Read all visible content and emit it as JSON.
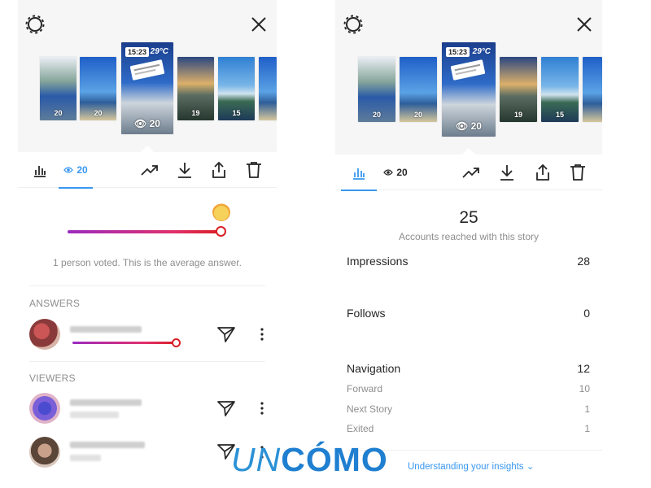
{
  "left_panel": {
    "thumbnails": [
      {
        "scene": "pool",
        "count": "20"
      },
      {
        "scene": "beach",
        "count": "20"
      },
      {
        "scene": "poll",
        "count": "20",
        "time_sticker": "15:23",
        "temp_sticker": "29°C"
      },
      {
        "scene": "sunset",
        "count": "19"
      },
      {
        "scene": "sky",
        "count": "15"
      },
      {
        "scene": "beach",
        "count": ""
      }
    ],
    "tabs": {
      "views_count": "20"
    },
    "poll": {
      "average_text": "1 person voted. This is the average answer.",
      "average_value": 1.0
    },
    "answers": {
      "title": "ANSWERS",
      "rows": [
        {
          "answer_value": 1.0
        }
      ]
    },
    "viewers": {
      "title": "VIEWERS"
    }
  },
  "right_panel": {
    "thumbnails": [
      {
        "scene": "pool",
        "count": "20"
      },
      {
        "scene": "beach",
        "count": "20"
      },
      {
        "scene": "poll",
        "count": "20",
        "time_sticker": "15:23",
        "temp_sticker": "29°C"
      },
      {
        "scene": "sunset",
        "count": "19"
      },
      {
        "scene": "sky",
        "count": "15"
      },
      {
        "scene": "beach",
        "count": ""
      }
    ],
    "tabs": {
      "views_count": "20"
    },
    "reach": {
      "value": "25",
      "label": "Accounts reached with this story"
    },
    "stats": {
      "impressions": {
        "label": "Impressions",
        "value": "28"
      },
      "follows": {
        "label": "Follows",
        "value": "0"
      },
      "navigation": {
        "label": "Navigation",
        "value": "12"
      },
      "forward": {
        "label": "Forward",
        "value": "10"
      },
      "next_story": {
        "label": "Next Story",
        "value": "1"
      },
      "exited": {
        "label": "Exited",
        "value": "1"
      }
    },
    "footer_link": "Understanding your insights ⌄"
  },
  "logo": {
    "un": "UN",
    "como": "CÓMO"
  },
  "colors": {
    "accent_blue": "#3897f0",
    "slider_start": "#9b2bbf",
    "slider_end": "#d91f26",
    "logo_blue": "#1f7fd0"
  },
  "icons": [
    "gear-icon",
    "close-icon",
    "bar-chart-icon",
    "eye-icon",
    "trending-icon",
    "download-icon",
    "share-icon",
    "trash-icon",
    "send-icon",
    "more-icon",
    "sun-emoji-icon"
  ]
}
